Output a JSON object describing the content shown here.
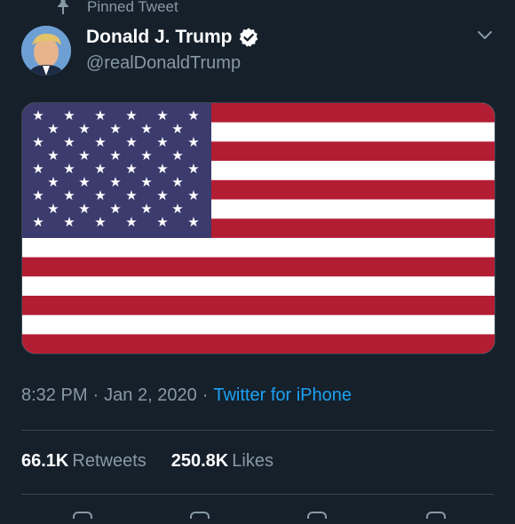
{
  "pinned": {
    "label": "Pinned Tweet",
    "icon": "pin-icon"
  },
  "user": {
    "display_name": "Donald J. Trump",
    "handle": "@realDonaldTrump",
    "verified": true,
    "avatar_icon": "avatar"
  },
  "media": {
    "description_icon": "us-flag-image"
  },
  "tweet": {
    "time": "8:32 PM",
    "separator": "·",
    "date": "Jan 2, 2020",
    "source": "Twitter for iPhone"
  },
  "stats": {
    "retweets_count": "66.1K",
    "retweets_label": "Retweets",
    "likes_count": "250.8K",
    "likes_label": "Likes"
  },
  "colors": {
    "background": "#15202b",
    "secondary_text": "#8899a6",
    "accent": "#1da1f2",
    "divider": "#38444d"
  }
}
